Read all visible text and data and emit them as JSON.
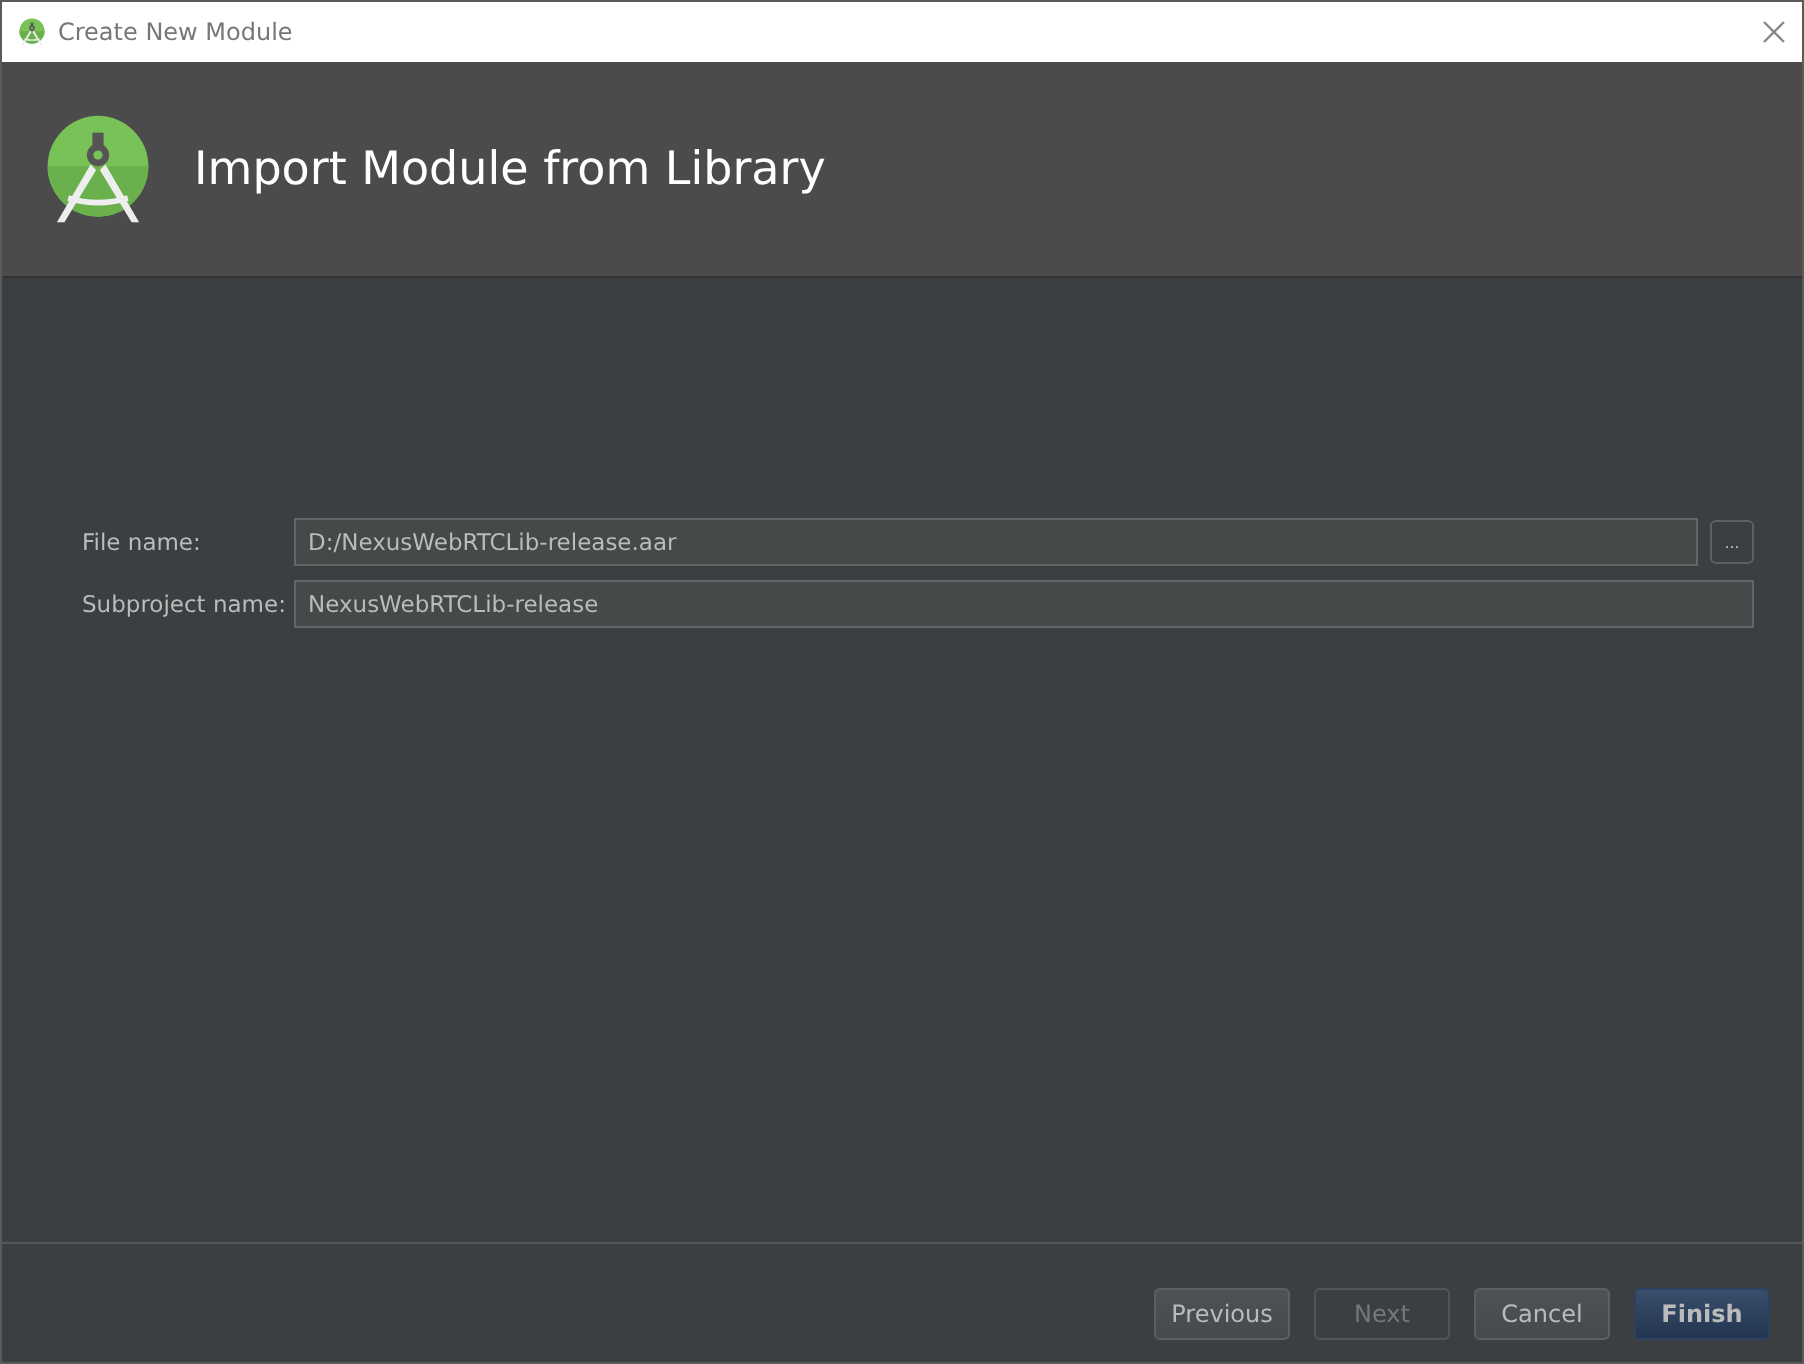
{
  "window": {
    "title": "Create New Module"
  },
  "header": {
    "title": "Import Module from Library"
  },
  "fields": [
    {
      "label": "File name:",
      "value": "D:/NexusWebRTCLib-release.aar",
      "browse": "..."
    },
    {
      "label": "Subproject name:",
      "value": "NexusWebRTCLib-release"
    }
  ],
  "buttons": [
    {
      "label": "Previous",
      "kind": "default",
      "disabled": false
    },
    {
      "label": "Next",
      "kind": "default",
      "disabled": true
    },
    {
      "label": "Cancel",
      "kind": "default",
      "disabled": false
    },
    {
      "label": "Finish",
      "kind": "primary",
      "disabled": false
    }
  ]
}
